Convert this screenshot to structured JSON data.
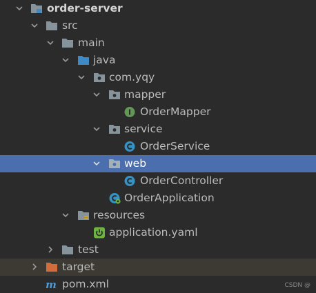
{
  "project_tree": {
    "root": {
      "label": "order-server"
    },
    "src": {
      "label": "src"
    },
    "main": {
      "label": "main"
    },
    "java": {
      "label": "java"
    },
    "package": {
      "label": "com.yqy"
    },
    "mapper": {
      "label": "mapper"
    },
    "order_mapper": {
      "label": "OrderMapper"
    },
    "service": {
      "label": "service"
    },
    "order_service": {
      "label": "OrderService"
    },
    "web": {
      "label": "web"
    },
    "order_controller": {
      "label": "OrderController"
    },
    "order_application": {
      "label": "OrderApplication"
    },
    "resources": {
      "label": "resources"
    },
    "application_yaml": {
      "label": "application.yaml"
    },
    "test": {
      "label": "test"
    },
    "target": {
      "label": "target"
    },
    "pom": {
      "label": "pom.xml"
    }
  },
  "watermark": "CSDN @",
  "colors": {
    "background": "#2b2b2b",
    "selection": "#4b6eaf",
    "excluded_row": "#3c3a33",
    "folder": "#87939a",
    "source_folder": "#3d8ac7",
    "class_icon": "#3592c4",
    "interface_icon": "#629755",
    "target_folder": "#d36c3a",
    "maven": "#4e9ad7",
    "spring": "#6db33f"
  }
}
